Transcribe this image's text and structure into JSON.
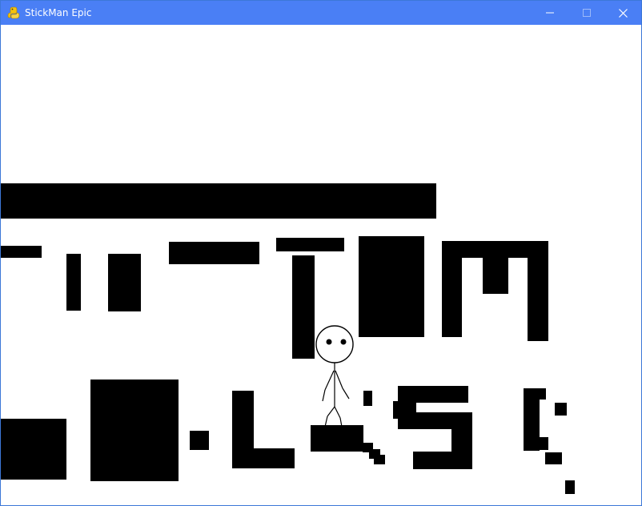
{
  "window": {
    "title": "StickMan Epic",
    "icon": "python-snake-icon",
    "titlebar_color": "#4a7ff5"
  },
  "controls": {
    "minimize_icon": "minimize-icon",
    "maximize_icon": "maximize-icon",
    "close_icon": "close-icon"
  },
  "game": {
    "background_color": "#ffffff",
    "block_color": "#000000",
    "player": "stickman"
  }
}
